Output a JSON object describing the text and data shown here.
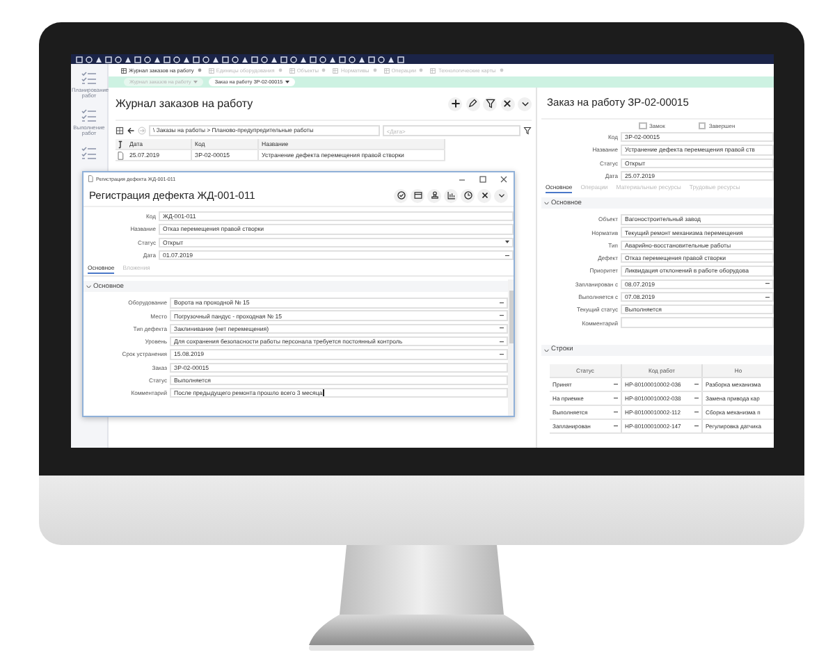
{
  "sidebar": {
    "items": [
      {
        "label": "Планирование работ"
      },
      {
        "label": "Выполнение работ"
      }
    ]
  },
  "tabs": [
    {
      "label": "Журнал заказов на работу",
      "selected": true
    },
    {
      "label": "Единицы оборудования",
      "selected": false
    },
    {
      "label": "Объекты",
      "selected": false
    },
    {
      "label": "Нормативы",
      "selected": false
    },
    {
      "label": "Операции",
      "selected": false
    },
    {
      "label": "Технологические карты",
      "selected": false
    }
  ],
  "breadcrumbs": [
    {
      "label": "Журнал заказов на работу",
      "selected": false
    },
    {
      "label": "Заказ на работу ЗР-02-00015",
      "selected": true
    }
  ],
  "journal": {
    "title": "Журнал заказов на работу",
    "path": "\\ Заказы на работы > Планово-предупредительные работы",
    "date_placeholder": "<Дата>",
    "columns": [
      "Дата",
      "Код",
      "Название"
    ],
    "rows": [
      [
        "25.07.2019",
        "ЗР-02-00015",
        "Устранение дефекта перемещения правой створки"
      ]
    ]
  },
  "dialog": {
    "window_title": "Регистрация дефекта ЖД-001-011",
    "title": "Регистрация дефекта ЖД-001-011",
    "fields": [
      {
        "label": "Код",
        "value": "ЖД-001-011",
        "kind": "text"
      },
      {
        "label": "Название",
        "value": "Отказ перемещения правой створки",
        "kind": "text"
      },
      {
        "label": "Статус",
        "value": "Открыт",
        "kind": "select"
      },
      {
        "label": "Дата",
        "value": "01.07.2019",
        "kind": "lookup"
      }
    ],
    "tabs": [
      {
        "label": "Основное",
        "selected": true
      },
      {
        "label": "Вложения",
        "selected": false
      }
    ],
    "section": {
      "title": "Основное",
      "expanded": true
    },
    "section_fields": [
      {
        "label": "Оборудование",
        "value": "Ворота на проходной № 15",
        "kind": "lookup"
      },
      {
        "label": "Место",
        "value": "Погрузочный пандус - проходная № 15",
        "kind": "lookup"
      },
      {
        "label": "Тип дефекта",
        "value": "Заклинивание (нет перемещения)",
        "kind": "lookup"
      },
      {
        "label": "Уровень",
        "value": "Для сохранения безопасности работы персонала требуется постоянный контроль",
        "kind": "lookup"
      },
      {
        "label": "Срок устранения",
        "value": "15.08.2019",
        "kind": "lookup"
      },
      {
        "label": "Заказ",
        "value": "ЗР-02-00015",
        "kind": "text"
      },
      {
        "label": "Статус",
        "value": "Выполняется",
        "kind": "text"
      },
      {
        "label": "Комментарий",
        "value": "После предыдущего ремонта прошло всего 3 месяца",
        "kind": "text",
        "focused": true
      }
    ]
  },
  "order": {
    "title": "Заказ на работу ЗР-02-00015",
    "checkboxes": [
      {
        "label": "Замок",
        "checked": false
      },
      {
        "label": "Завершен",
        "checked": false
      }
    ],
    "fields": [
      {
        "label": "Код",
        "value": "ЗР-02-00015",
        "kind": "text"
      },
      {
        "label": "Название",
        "value": "Устранение дефекта перемещения правой ств",
        "kind": "text"
      },
      {
        "label": "Статус",
        "value": "Открыт",
        "kind": "text"
      },
      {
        "label": "Дата",
        "value": "25.07.2019",
        "kind": "text"
      }
    ],
    "tabs": [
      {
        "label": "Основное",
        "selected": true
      },
      {
        "label": "Операции",
        "selected": false
      },
      {
        "label": "Материальные ресурсы",
        "selected": false
      },
      {
        "label": "Трудовые ресурсы",
        "selected": false
      }
    ],
    "section": {
      "title": "Основное",
      "expanded": true
    },
    "section_fields": [
      {
        "label": "Объект",
        "value": "Вагоностроительный завод",
        "kind": "text"
      },
      {
        "label": "Норматив",
        "value": "Текущий ремонт механизма перемещения",
        "kind": "text"
      },
      {
        "label": "Тип",
        "value": "Аварийно-восстановительные работы",
        "kind": "text"
      },
      {
        "label": "Дефект",
        "value": "Отказ перемещения правой створки",
        "kind": "text"
      },
      {
        "label": "Приоритет",
        "value": "Ликвидация отклонений в работе оборудова",
        "kind": "text"
      },
      {
        "label": "Запланирован с",
        "value": "08.07.2019",
        "kind": "lookup"
      },
      {
        "label": "Выполняется с",
        "value": "07.08.2019",
        "kind": "lookup"
      },
      {
        "label": "Текущий статус",
        "value": "Выполняется",
        "kind": "text"
      },
      {
        "label": "Комментарий",
        "kind": "text"
      }
    ],
    "lines": {
      "title": "Строки",
      "expanded": true,
      "columns": [
        "Статус",
        "Код работ",
        "Но"
      ],
      "rows": [
        [
          "Принят",
          "НР-80100010002-036",
          "Разборка механизма"
        ],
        [
          "На приемке",
          "НР-80100010002-038",
          "Замена привода кар"
        ],
        [
          "Выполняется",
          "НР-80100010002-112",
          "Сборка механизма п"
        ],
        [
          "Запланирован",
          "НР-80100010002-147",
          "Регулировка датчика"
        ]
      ]
    }
  }
}
